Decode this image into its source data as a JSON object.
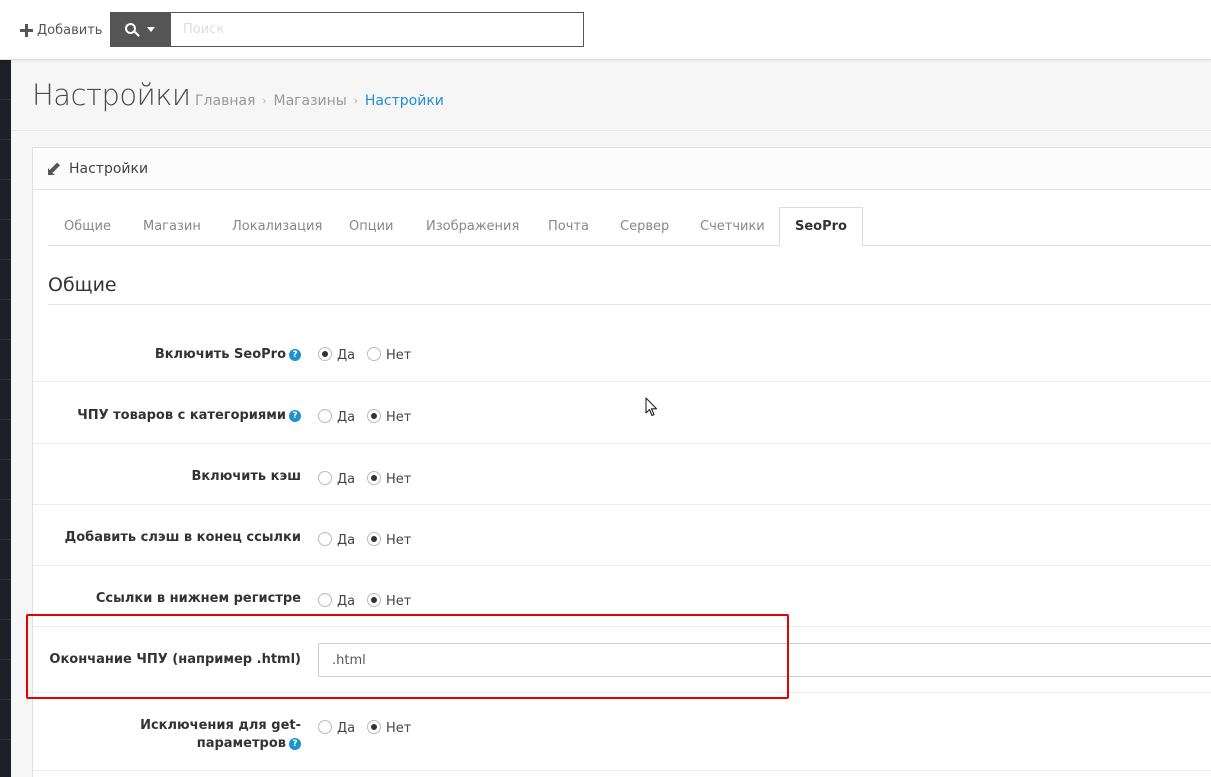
{
  "header": {
    "add_label": "Добавить",
    "search_placeholder": "Поиск"
  },
  "page": {
    "title": "Настройки",
    "breadcrumb": [
      "Главная",
      "Магазины",
      "Настройки"
    ]
  },
  "panel": {
    "heading": "Настройки",
    "tabs": [
      "Общие",
      "Магазин",
      "Локализация",
      "Опции",
      "Изображения",
      "Почта",
      "Сервер",
      "Счетчики",
      "SeoPro"
    ],
    "active_tab": "SeoPro",
    "section_title": "Общие"
  },
  "form": {
    "yes_label": "Да",
    "no_label": "Нет",
    "rows": [
      {
        "label": "Включить SeoPro",
        "help": true,
        "value": "yes"
      },
      {
        "label": "ЧПУ товаров с категориями",
        "help": true,
        "value": "no"
      },
      {
        "label": "Включить кэш",
        "help": false,
        "value": "no"
      },
      {
        "label": "Добавить слэш в конец ссылки",
        "help": false,
        "value": "no"
      },
      {
        "label": "Ссылки в нижнем регистре",
        "help": false,
        "value": "no"
      }
    ],
    "suffix_label": "Окончание ЧПУ (например .html)",
    "suffix_value": ".html",
    "exclusions_label_line1": "Исключения для get-",
    "exclusions_label_line2": "параметров",
    "exclusions_value": "no"
  },
  "colors": {
    "accent": "#1e91cf",
    "highlight": "#e60000",
    "sidebar": "#1c2127",
    "search_button": "#555555"
  }
}
